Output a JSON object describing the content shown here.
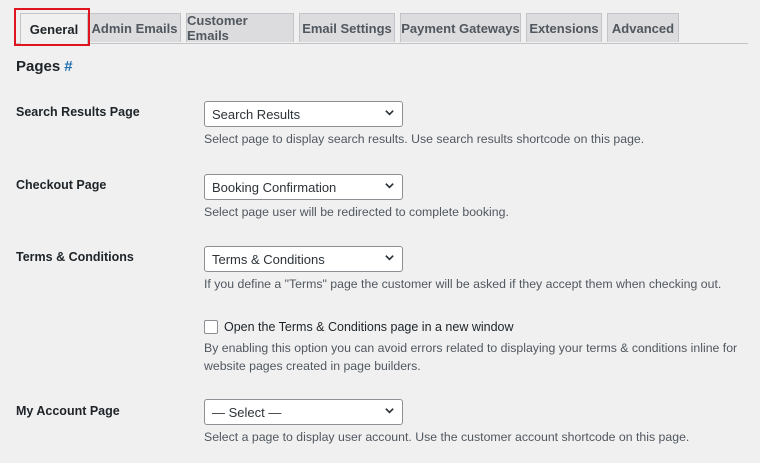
{
  "tabs": [
    {
      "label": "General",
      "active": true
    },
    {
      "label": "Admin Emails"
    },
    {
      "label": "Customer Emails"
    },
    {
      "label": "Email Settings"
    },
    {
      "label": "Payment Gateways"
    },
    {
      "label": "Extensions"
    },
    {
      "label": "Advanced"
    }
  ],
  "section": {
    "title": "Pages",
    "anchor": "#"
  },
  "fields": {
    "search_results": {
      "label": "Search Results Page",
      "value": "Search Results",
      "description": "Select page to display search results. Use search results shortcode on this page."
    },
    "checkout": {
      "label": "Checkout Page",
      "value": "Booking Confirmation",
      "description": "Select page user will be redirected to complete booking."
    },
    "terms": {
      "label": "Terms & Conditions",
      "value": "Terms & Conditions",
      "description": "If you define a \"Terms\" page the customer will be asked if they accept them when checking out.",
      "checkbox_label": "Open the Terms & Conditions page in a new window",
      "checkbox_checked": false,
      "checkbox_description_line1": "By enabling this option you can avoid errors related to displaying your terms & conditions inline for",
      "checkbox_description_line2": "website pages created in page builders."
    },
    "my_account": {
      "label": "My Account Page",
      "value": "— Select —",
      "description": "Select a page to display user account. Use the customer account shortcode on this page."
    }
  },
  "colors": {
    "highlight": "#e0141e",
    "link": "#2271b1",
    "background": "#f0f0f1"
  }
}
